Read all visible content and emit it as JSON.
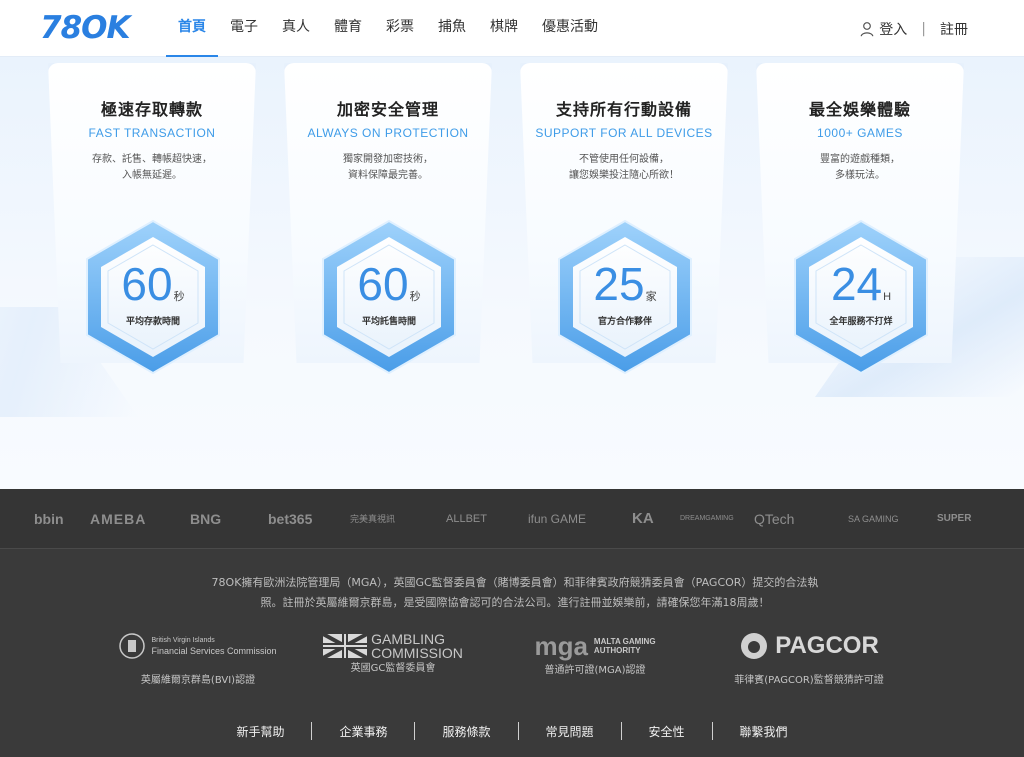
{
  "header": {
    "logo_text": "78OK",
    "nav": [
      "首頁",
      "電子",
      "真人",
      "體育",
      "彩票",
      "捕魚",
      "棋牌",
      "優惠活動"
    ],
    "active_index": 0,
    "login": "登入",
    "register": "註冊",
    "separator": "|"
  },
  "features": [
    {
      "title": "極速存取轉款",
      "subtitle": "FAST TRANSACTION",
      "desc1": "存款、託售、轉帳超快速，",
      "desc2": "入帳無延遲。",
      "number": "60",
      "unit": "秒",
      "label": "平均存款時間"
    },
    {
      "title": "加密安全管理",
      "subtitle": "ALWAYS ON PROTECTION",
      "desc1": "獨家開發加密技術，",
      "desc2": "資料保障最完善。",
      "number": "60",
      "unit": "秒",
      "label": "平均託售時間"
    },
    {
      "title": "支持所有行動設備",
      "subtitle": "SUPPORT FOR ALL DEVICES",
      "desc1": "不管使用任何設備，",
      "desc2": "讓您娛樂投注隨心所欲！",
      "number": "25",
      "unit": "家",
      "label": "官方合作夥伴"
    },
    {
      "title": "最全娛樂體驗",
      "subtitle": "1000+ GAMES",
      "desc1": "豐富的遊戲種類，",
      "desc2": "多樣玩法。",
      "number": "24",
      "unit": "H",
      "label": "全年服務不打烊"
    }
  ],
  "providers": [
    "bbin",
    "AMEBA",
    "BNG",
    "bet365",
    "完美真視訊",
    "ALLBET",
    "ifun GAME",
    "KA",
    "DREAMGAMING",
    "QTech",
    "SA GAMING",
    "SUPER"
  ],
  "legal": {
    "line1": "78OK擁有歐洲法院管理局（MGA），英國GC監督委員會（賭博委員會）和菲律賓政府競猜委員會（PAGCOR）提交的合法執",
    "line2": "照。註冊於英屬維爾京群島，是受國際協會認可的合法公司。進行註冊並娛樂前，請確保您年滿18周歲！"
  },
  "licenses": [
    {
      "logo_line1": "British Virgin Islands",
      "logo_line2": "Financial Services Commission",
      "caption": "英屬維爾京群島(BVI)認證"
    },
    {
      "logo_line1": "GAMBLING",
      "logo_line2": "COMMISSION",
      "caption": "英國GC監督委員會"
    },
    {
      "logo_main": "mga",
      "logo_line1": "MALTA GAMING",
      "logo_line2": "AUTHORITY",
      "caption": "普通許可證(MGA)認證"
    },
    {
      "logo_main": "PAGCOR",
      "caption": "菲律賓(PAGCOR)監督競猜許可證"
    }
  ],
  "footer_links": [
    "新手幫助",
    "企業事務",
    "服務條款",
    "常見問題",
    "安全性",
    "聯繫我們"
  ],
  "colors": {
    "accent": "#2a86e8",
    "footer_bg": "#3a3a3a",
    "hex_blue": "#5aaef0"
  }
}
